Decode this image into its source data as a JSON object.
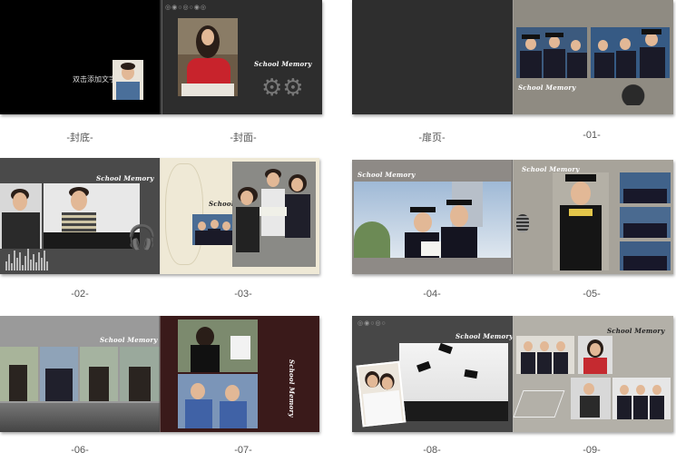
{
  "cover": {
    "add_text": "双击添加文字"
  },
  "labels": {
    "back_cover": "-封底-",
    "front_cover": "-封面-",
    "flyleaf": "-扉页-",
    "p01": "-01-",
    "p02": "-02-",
    "p03": "-03-",
    "p04": "-04-",
    "p05": "-05-",
    "p06": "-06-",
    "p07": "-07-",
    "p08": "-08-",
    "p09": "-09-"
  },
  "brand": {
    "title": "School Memory"
  },
  "colors": {
    "dark_page": "#2b2b2b",
    "cream_page": "#efe9d6",
    "grey_page": "#8e8a80",
    "maroon_page": "#3a1a1a"
  }
}
